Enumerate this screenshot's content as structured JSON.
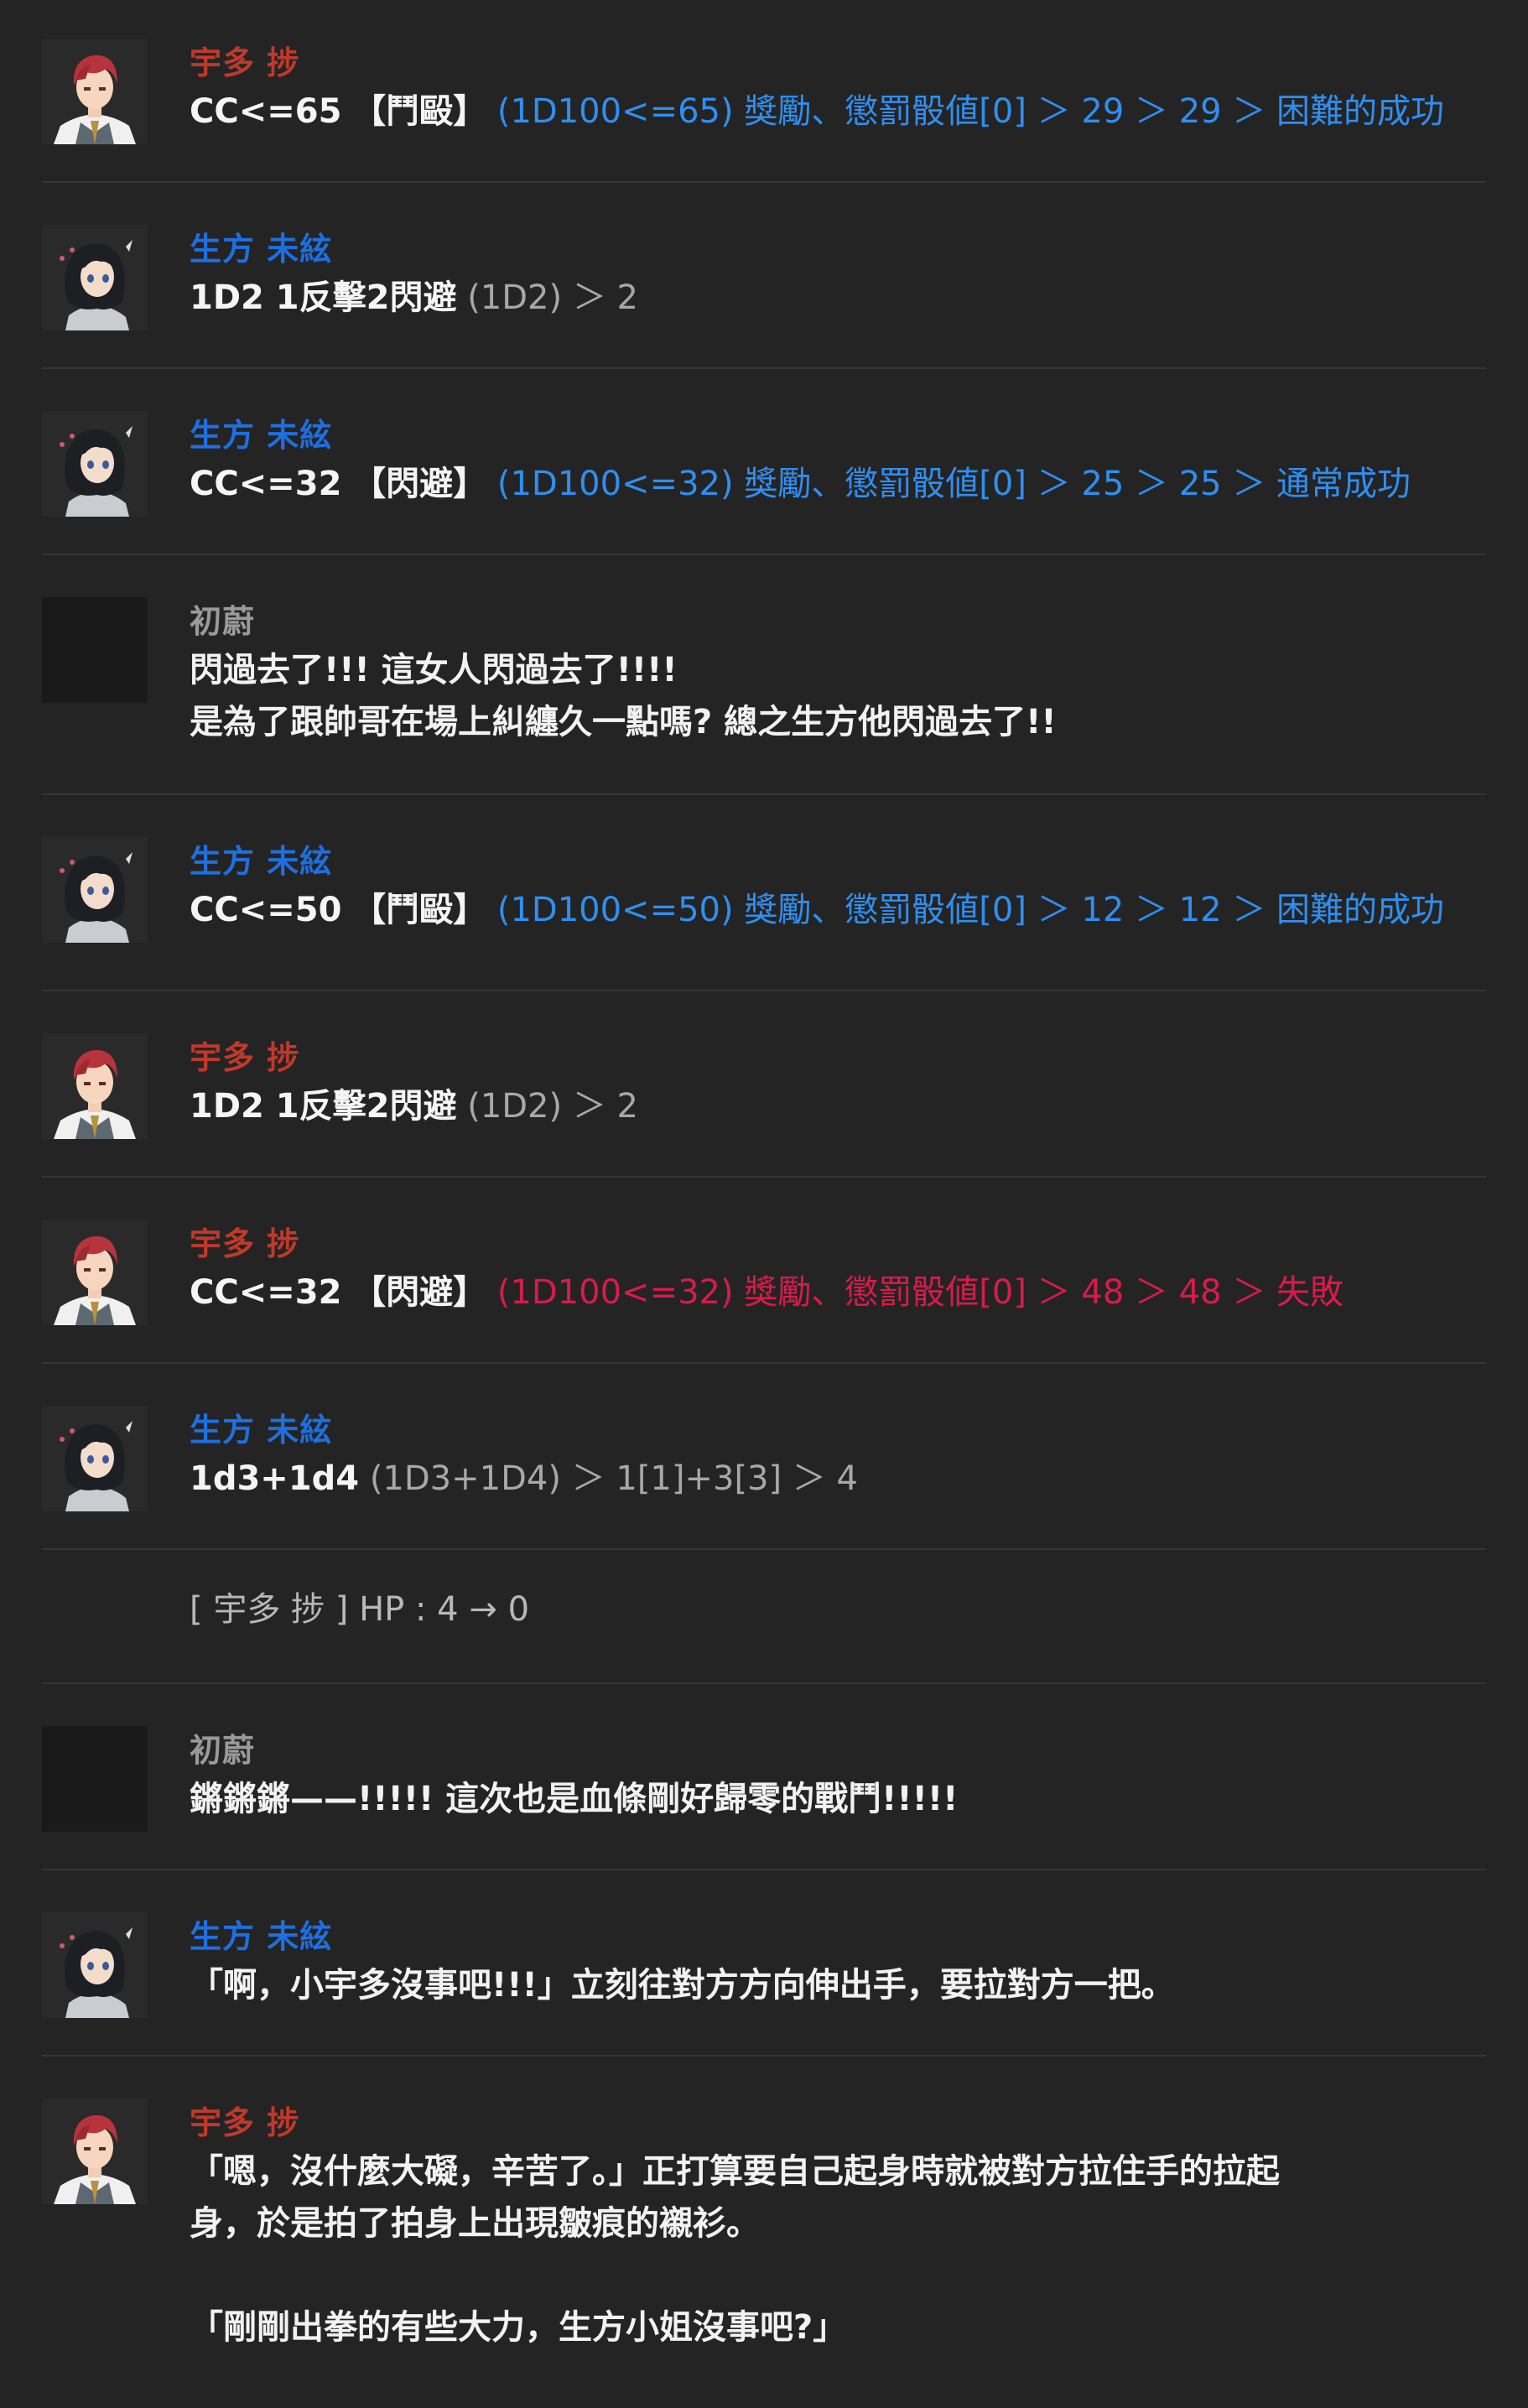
{
  "messages": [
    {
      "speaker": "宇多 捗",
      "cmd": "CC<=65",
      "skill": "【鬥毆】",
      "result": "(1D100<=65) 獎勵、懲罰骰値[0] ＞ 29 ＞ 29 ＞ 困難的成功"
    },
    {
      "speaker": "生方 未絃",
      "cmd": "1D2 1反擊2閃避",
      "result": "(1D2) ＞ 2"
    },
    {
      "speaker": "生方 未絃",
      "cmd": "CC<=32",
      "skill": "【閃避】",
      "result": "(1D100<=32) 獎勵、懲罰骰値[0] ＞ 25 ＞ 25 ＞ 通常成功"
    },
    {
      "speaker": "初蔚",
      "line1": "閃過去了!!! 這女人閃過去了!!!!",
      "line2": "是為了跟帥哥在場上糾纏久一點嗎? 總之生方他閃過去了!!"
    },
    {
      "speaker": "生方 未絃",
      "cmd": "CC<=50",
      "skill": "【鬥毆】",
      "result": "(1D100<=50) 獎勵、懲罰骰値[0] ＞ 12 ＞ 12 ＞ 困難的成功"
    },
    {
      "speaker": "宇多 捗",
      "cmd": "1D2 1反擊2閃避",
      "result": "(1D2) ＞ 2"
    },
    {
      "speaker": "宇多 捗",
      "cmd": "CC<=32",
      "skill": "【閃避】",
      "result": "(1D100<=32) 獎勵、懲罰骰値[0] ＞ 48 ＞ 48 ＞ 失敗"
    },
    {
      "speaker": "生方 未絃",
      "cmd": "1d3+1d4",
      "result": "(1D3+1D4) ＞ 1[1]+3[3] ＞ 4"
    },
    {
      "system": "[ 宇多 捗 ] HP : 4 → 0"
    },
    {
      "speaker": "初蔚",
      "line1": "鏘鏘鏘——!!!!! 這次也是血條剛好歸零的戰鬥!!!!!"
    },
    {
      "speaker": "生方 未絃",
      "line1": "「啊，小宇多沒事吧!!!」立刻往對方方向伸出手，要拉對方一把。"
    },
    {
      "speaker": "宇多 捗",
      "line1": "「嗯，沒什麼大礙，辛苦了。」正打算要自己起身時就被對方拉住手的拉起",
      "line2": "身，於是拍了拍身上出現皺痕的襯衫。",
      "line3": "「剛剛出拳的有些大力，生方小姐沒事吧?」"
    }
  ],
  "colors": {
    "background": "#242424",
    "uta": "#c0392b",
    "ubukata": "#1e6fe0",
    "gm": "#9a9a9a",
    "roll_success": "#2f8ff0",
    "roll_fail": "#d81b4a"
  },
  "icons": {
    "uta_avatar": "red-haired-man-in-vest-avatar",
    "ubukata_avatar": "black-haired-woman-avatar",
    "gm_avatar": "blank-avatar"
  }
}
